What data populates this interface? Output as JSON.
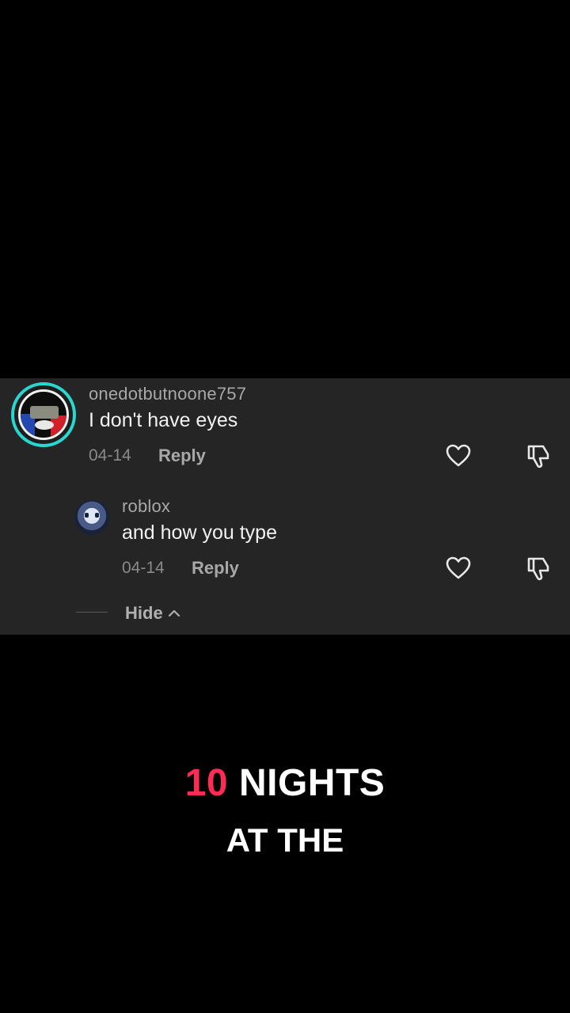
{
  "comments": [
    {
      "username": "onedotbutnoone757",
      "text": "I don't have eyes",
      "date": "04-14",
      "reply_label": "Reply",
      "like_icon": "heart-outline-icon",
      "dislike_icon": "thumbs-down-icon"
    },
    {
      "username": "roblox",
      "text": "and how you type",
      "date": "04-14",
      "reply_label": "Reply",
      "like_icon": "heart-outline-icon",
      "dislike_icon": "thumbs-down-icon"
    }
  ],
  "hide_label": "Hide",
  "caption": {
    "number": "10",
    "word": "NIGHTS",
    "line2": "AT THE"
  },
  "colors": {
    "accent": "#fe2c55",
    "avatar_ring": "#2ad6d0",
    "panel_bg": "#252525"
  }
}
